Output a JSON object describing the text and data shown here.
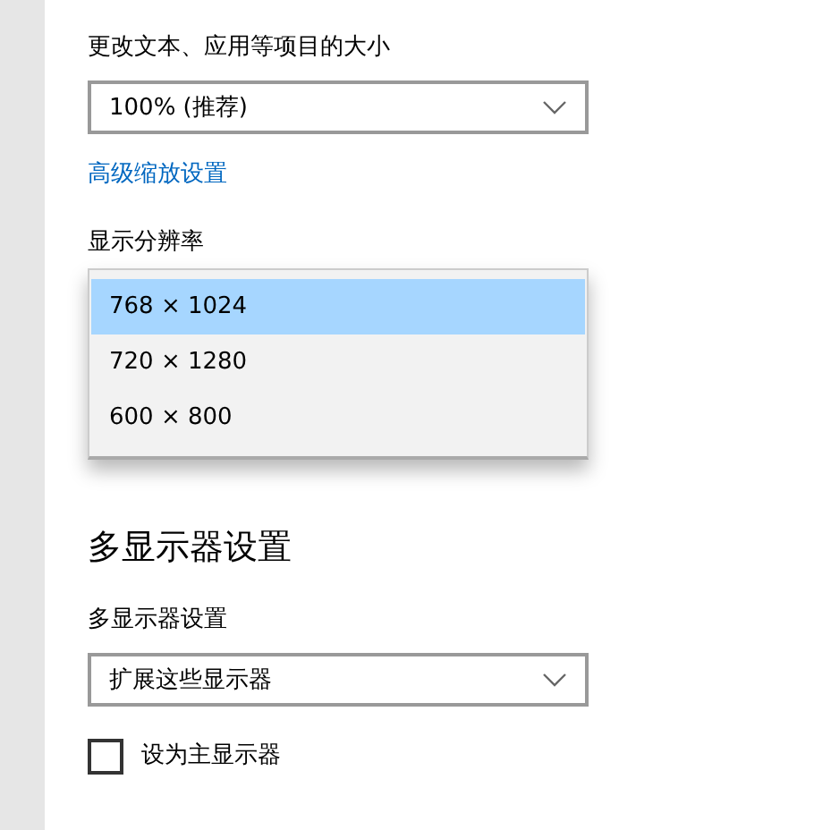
{
  "scale": {
    "label": "更改文本、应用等项目的大小",
    "value": "100% (推荐)"
  },
  "advanced_link": "高级缩放设置",
  "resolution": {
    "label": "显示分辨率",
    "options": [
      {
        "label": "768 × 1024",
        "selected": true
      },
      {
        "label": "720 × 1280",
        "selected": false
      },
      {
        "label": "600 × 800",
        "selected": false
      }
    ]
  },
  "multi_display": {
    "heading": "多显示器设置",
    "label": "多显示器设置",
    "value": "扩展这些显示器"
  },
  "primary_checkbox": {
    "label": "设为主显示器",
    "checked": false
  }
}
